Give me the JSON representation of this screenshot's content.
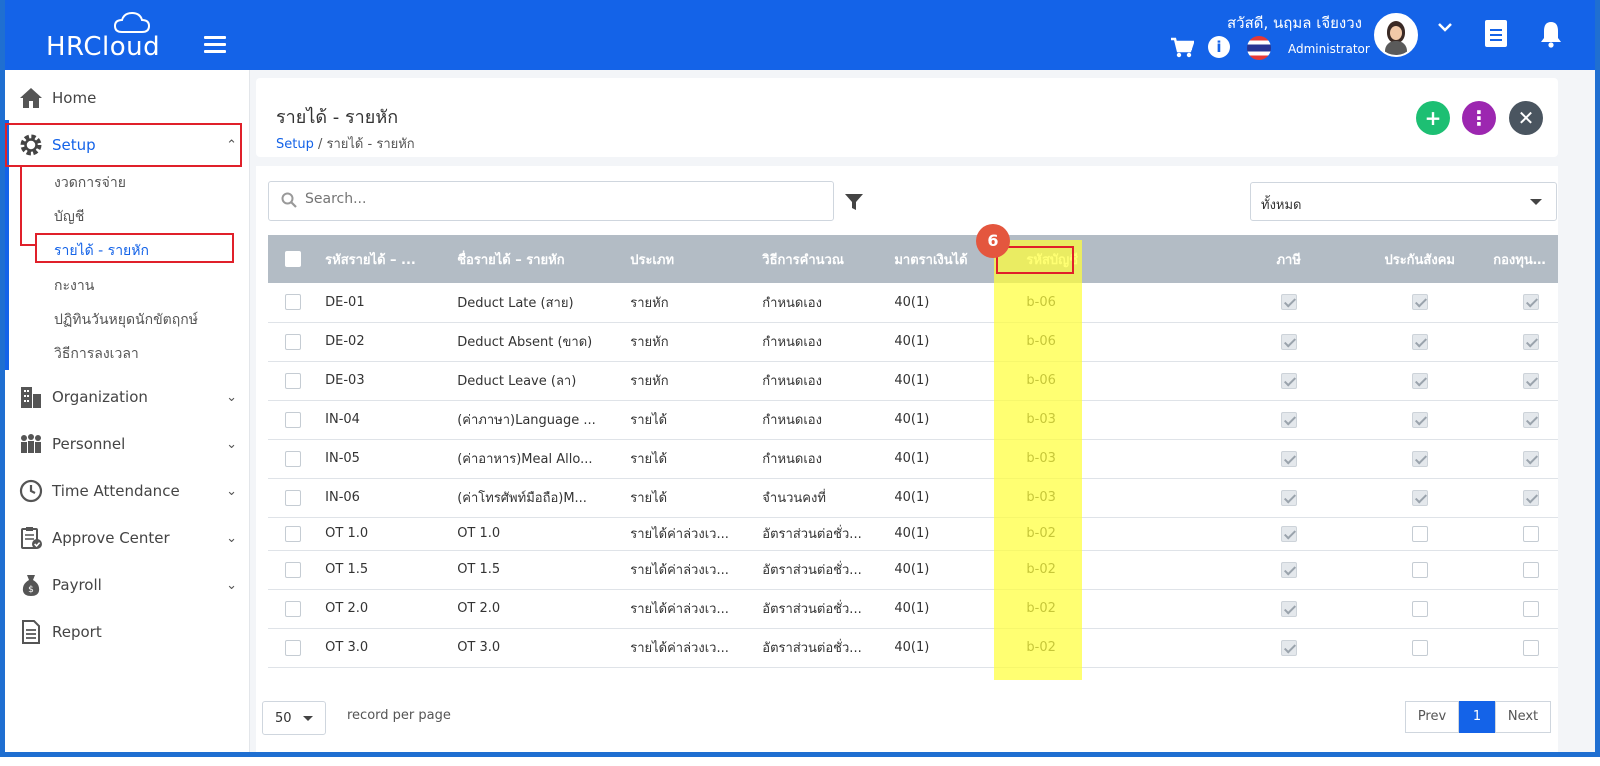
{
  "header": {
    "logo_text": "HRCloud",
    "greeting": "สวัสดี, นฤมล เจียงวง",
    "role": "Administrator"
  },
  "sidebar": {
    "items": [
      {
        "label": "Home",
        "icon": "home-icon"
      },
      {
        "label": "Setup",
        "icon": "gear-icon"
      },
      {
        "label": "Organization",
        "icon": "building-icon"
      },
      {
        "label": "Personnel",
        "icon": "people-icon"
      },
      {
        "label": "Time Attendance",
        "icon": "clock-icon"
      },
      {
        "label": "Approve Center",
        "icon": "clipboard-check-icon"
      },
      {
        "label": "Payroll",
        "icon": "money-bag-icon"
      },
      {
        "label": "Report",
        "icon": "report-icon"
      }
    ],
    "setup_sub": [
      "งวดการจ่าย",
      "บัญชี",
      "รายได้ - รายหัก",
      "กะงาน",
      "ปฏิทินวันหยุดนักขัตฤกษ์",
      "วิธีการลงเวลา"
    ]
  },
  "page": {
    "title": "รายได้ - รายหัก",
    "breadcrumb_root": "Setup",
    "breadcrumb_current": "/ รายได้ - รายหัก"
  },
  "toolbar": {
    "search_placeholder": "Search...",
    "filter_value": "ทั้งหมด"
  },
  "table": {
    "headers": [
      "รหัสรายได้ – ...",
      "ชื่อรายได้ – รายหัก",
      "ประเภท",
      "วิธีการคำนวณ",
      "มาตราเงินได้",
      "รหัสบัญชี",
      "ภาษี",
      "ประกันสังคม",
      "กองทุนสำร..."
    ],
    "rows": [
      {
        "code": "DE-01",
        "name": "Deduct Late (สาย)",
        "type": "รายหัก",
        "method": "กำหนดเอง",
        "section": "40(1)",
        "account": "b-06",
        "tax": true,
        "sso": true,
        "fund": true
      },
      {
        "code": "DE-02",
        "name": "Deduct Absent (ขาด)",
        "type": "รายหัก",
        "method": "กำหนดเอง",
        "section": "40(1)",
        "account": "b-06",
        "tax": true,
        "sso": true,
        "fund": true
      },
      {
        "code": "DE-03",
        "name": "Deduct Leave (ลา)",
        "type": "รายหัก",
        "method": "กำหนดเอง",
        "section": "40(1)",
        "account": "b-06",
        "tax": true,
        "sso": true,
        "fund": true
      },
      {
        "code": "IN-04",
        "name": "(ค่าภาษา)Language ...",
        "type": "รายได้",
        "method": "กำหนดเอง",
        "section": "40(1)",
        "account": "b-03",
        "tax": true,
        "sso": true,
        "fund": true
      },
      {
        "code": "IN-05",
        "name": "(ค่าอาหาร)Meal Allo...",
        "type": "รายได้",
        "method": "กำหนดเอง",
        "section": "40(1)",
        "account": "b-03",
        "tax": true,
        "sso": true,
        "fund": true
      },
      {
        "code": "IN-06",
        "name": "(ค่าโทรศัพท์มือถือ)M...",
        "type": "รายได้",
        "method": "จำนวนคงที่",
        "section": "40(1)",
        "account": "b-03",
        "tax": true,
        "sso": true,
        "fund": true
      },
      {
        "code": "OT 1.0",
        "name": "OT 1.0",
        "type": "รายได้ค่าล่วงเว...",
        "method": "อัตราส่วนต่อชั่ว...",
        "section": "40(1)",
        "account": "b-02",
        "tax": true,
        "sso": false,
        "fund": false
      },
      {
        "code": "OT 1.5",
        "name": "OT 1.5",
        "type": "รายได้ค่าล่วงเว...",
        "method": "อัตราส่วนต่อชั่ว...",
        "section": "40(1)",
        "account": "b-02",
        "tax": true,
        "sso": false,
        "fund": false
      },
      {
        "code": "OT 2.0",
        "name": "OT 2.0",
        "type": "รายได้ค่าล่วงเว...",
        "method": "อัตราส่วนต่อชั่ว...",
        "section": "40(1)",
        "account": "b-02",
        "tax": true,
        "sso": false,
        "fund": false
      },
      {
        "code": "OT 3.0",
        "name": "OT 3.0",
        "type": "รายได้ค่าล่วงเว...",
        "method": "อัตราส่วนต่อชั่ว...",
        "section": "40(1)",
        "account": "b-02",
        "tax": true,
        "sso": false,
        "fund": false
      }
    ]
  },
  "annotation": {
    "step": "6"
  },
  "pagination": {
    "page_size": "50",
    "record_label": "record per page",
    "prev": "Prev",
    "current": "1",
    "next": "Next"
  },
  "colors": {
    "brand": "#1463e8",
    "add": "#1dbf73",
    "more": "#9c27b0",
    "close": "#4a5560",
    "highlight": "#ffff3c",
    "annotation": "#e0202a"
  }
}
